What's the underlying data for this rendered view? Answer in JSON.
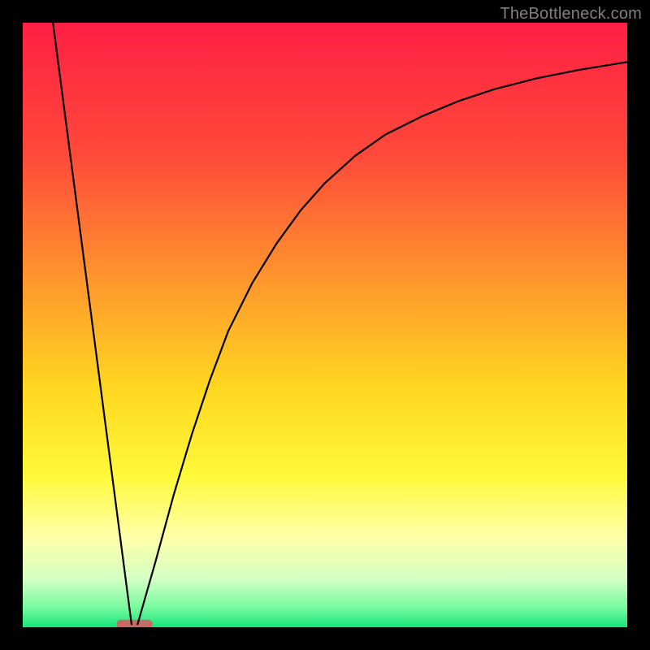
{
  "watermark": "TheBottleneck.com",
  "chart_data": {
    "type": "line",
    "title": "",
    "xlabel": "",
    "ylabel": "",
    "xlim": [
      0,
      100
    ],
    "ylim": [
      0,
      100
    ],
    "grid": false,
    "background_gradient": {
      "stops": [
        {
          "offset": 0.0,
          "color": "#ff1f44"
        },
        {
          "offset": 0.22,
          "color": "#ff4a3a"
        },
        {
          "offset": 0.45,
          "color": "#ff9f2c"
        },
        {
          "offset": 0.6,
          "color": "#ffd61f"
        },
        {
          "offset": 0.75,
          "color": "#fff93a"
        },
        {
          "offset": 0.85,
          "color": "#ffffa9"
        },
        {
          "offset": 0.92,
          "color": "#d4ffc3"
        },
        {
          "offset": 0.965,
          "color": "#7dfba1"
        },
        {
          "offset": 1.0,
          "color": "#18e57c"
        }
      ]
    },
    "optimal_marker": {
      "x_start": 15.5,
      "x_end": 21.5,
      "y": 0.5,
      "color": "#c86a68"
    },
    "series": [
      {
        "name": "left-falling-line",
        "color": "#000000",
        "x": [
          5.0,
          18.0
        ],
        "y": [
          100.0,
          0.5
        ]
      },
      {
        "name": "right-rising-curve",
        "color": "#000000",
        "x": [
          19.0,
          22,
          25,
          28,
          31,
          34,
          38,
          42,
          46,
          50,
          55,
          60,
          66,
          72,
          78,
          85,
          92,
          100
        ],
        "y": [
          0.5,
          11,
          22,
          32,
          41,
          49,
          57,
          63.5,
          69,
          73.5,
          78,
          81.5,
          84.5,
          87,
          89,
          90.8,
          92.2,
          93.5
        ]
      }
    ]
  }
}
